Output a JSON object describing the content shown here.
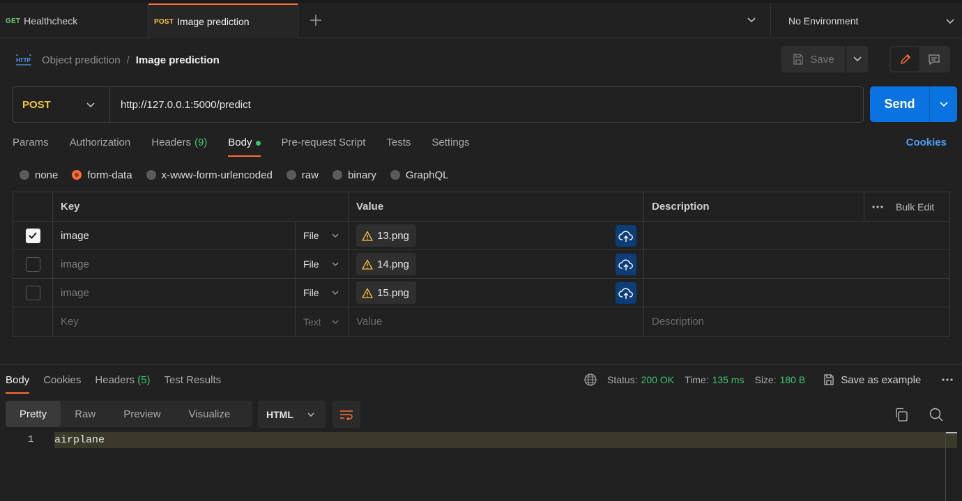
{
  "tabs": [
    {
      "method": "GET",
      "title": "Healthcheck"
    },
    {
      "method": "POST",
      "title": "Image prediction"
    }
  ],
  "environment": {
    "label": "No Environment"
  },
  "breadcrumb": {
    "icon": "http-icon",
    "parent": "Object prediction",
    "separator": "/",
    "current": "Image prediction"
  },
  "toolbar": {
    "save_label": "Save"
  },
  "request": {
    "method": "POST",
    "url": "http://127.0.0.1:5000/predict",
    "send_label": "Send"
  },
  "request_tabs": [
    {
      "label": "Params"
    },
    {
      "label": "Authorization"
    },
    {
      "label": "Headers",
      "count": "(9)"
    },
    {
      "label": "Body"
    },
    {
      "label": "Pre-request Script"
    },
    {
      "label": "Tests"
    },
    {
      "label": "Settings"
    }
  ],
  "cookies_label": "Cookies",
  "body_types": [
    "none",
    "form-data",
    "x-www-form-urlencoded",
    "raw",
    "binary",
    "GraphQL"
  ],
  "body_type_selected": "form-data",
  "form_table": {
    "headers": {
      "key": "Key",
      "value": "Value",
      "description": "Description",
      "bulk_edit": "Bulk Edit"
    },
    "rows": [
      {
        "checked": true,
        "key": "image",
        "type": "File",
        "file": "13.png"
      },
      {
        "checked": false,
        "key": "image",
        "type": "File",
        "file": "14.png"
      },
      {
        "checked": false,
        "key": "image",
        "type": "File",
        "file": "15.png"
      }
    ],
    "empty_row": {
      "key": "Key",
      "type": "Text",
      "value": "Value",
      "description": "Description"
    }
  },
  "response": {
    "tabs": [
      {
        "label": "Body"
      },
      {
        "label": "Cookies"
      },
      {
        "label": "Headers",
        "count": "(5)"
      },
      {
        "label": "Test Results"
      }
    ],
    "status_label": "Status:",
    "status_value": "200 OK",
    "time_label": "Time:",
    "time_value": "135 ms",
    "size_label": "Size:",
    "size_value": "180 B",
    "save_example": "Save as example",
    "view_tabs": [
      "Pretty",
      "Raw",
      "Preview",
      "Visualize"
    ],
    "language": "HTML",
    "code_lines": [
      {
        "number": "1",
        "text": "airplane"
      }
    ]
  },
  "colors": {
    "accent": "#ff6c37",
    "send": "#0b73e0",
    "success": "#3ec46d",
    "method_post": "#f5c542",
    "method_get": "#6bc46b",
    "link": "#4c9cf0"
  }
}
